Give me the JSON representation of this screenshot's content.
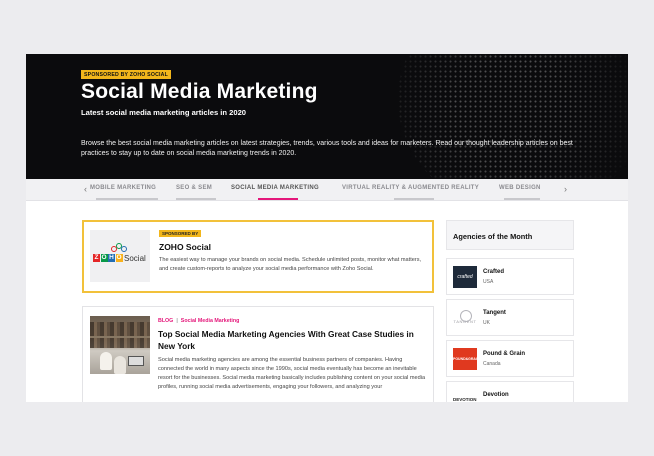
{
  "hero": {
    "sponsor_tag": "SPONSORED BY ZOHO SOCIAL",
    "title": "Social Media Marketing",
    "subtitle": "Latest social media marketing articles in 2020",
    "description": "Browse the best social media marketing articles on latest strategies, trends, various tools and ideas for marketers. Read our thought leadership articles on best practices to stay up to date on social media marketing trends in 2020."
  },
  "tabs": {
    "items": [
      {
        "label": "MOBILE MARKETING",
        "active": false
      },
      {
        "label": "SEO & SEM",
        "active": false
      },
      {
        "label": "SOCIAL MEDIA MARKETING",
        "active": true
      },
      {
        "label": "VIRTUAL REALITY & AUGMENTED REALITY",
        "active": false
      },
      {
        "label": "WEB DESIGN",
        "active": false
      }
    ],
    "prev_icon": "chevron-left-icon",
    "next_icon": "chevron-right-icon",
    "active_color": "#e4177a"
  },
  "sponsored": {
    "badge": "SPONSORED BY",
    "title": "ZOHO Social",
    "logo_text": "Social",
    "logo_letters": [
      "Z",
      "O",
      "H",
      "O"
    ],
    "logo_colors": [
      "#e42527",
      "#089949",
      "#226db4",
      "#f9b21d"
    ],
    "description": "The easiest way to manage your brands on social media. Schedule unlimited posts, monitor what matters, and create custom-reports to analyze your social media performance with Zoho Social.",
    "border_color": "#f2c13a"
  },
  "article": {
    "category": "BLOG",
    "separator": "|",
    "tag": "Social Media Marketing",
    "title": "Top Social Media Marketing Agencies With Great Case Studies in New York",
    "description": "Social media marketing agencies are among the essential business partners of companies. Having connected the world in many aspects since the 1990s, social media eventually has become an inevitable resort for the businesses. Social media marketing basically includes publishing content on your social media profiles, running social media advertisements, engaging your followers, and analyzing your"
  },
  "sidebar": {
    "title": "Agencies of the Month",
    "agencies": [
      {
        "name": "Crafted",
        "country": "USA",
        "logo_text": "crafted"
      },
      {
        "name": "Tangent",
        "country": "UK",
        "logo_text": "TANGENT"
      },
      {
        "name": "Pound & Grain",
        "country": "Canada",
        "logo_text": "POUND&GRAIN"
      },
      {
        "name": "Devotion",
        "country": "",
        "logo_text": "DEVOTION"
      }
    ]
  }
}
